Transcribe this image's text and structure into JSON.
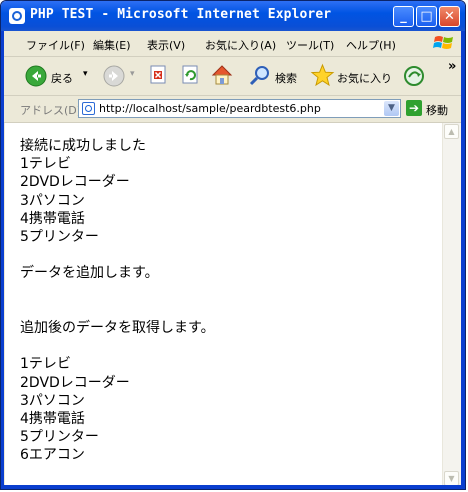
{
  "window": {
    "title": "PHP TEST - Microsoft Internet Explorer",
    "minimize_label": "_",
    "maximize_label": "□",
    "close_label": "✕"
  },
  "menu": {
    "items": [
      "ファイル(F)",
      "編集(E)",
      "表示(V)",
      "お気に入り(A)",
      "ツール(T)",
      "ヘルプ(H)"
    ]
  },
  "toolbar": {
    "back_label": "戻る",
    "search_label": "検索",
    "favorites_label": "お気に入り",
    "overflow_label": "»",
    "icons": [
      "back-icon",
      "forward-icon",
      "stop-icon",
      "refresh-icon",
      "home-icon",
      "search-icon",
      "favorites-icon",
      "media-icon"
    ]
  },
  "address": {
    "label": "アドレス(D)",
    "url": "http://localhost/sample/peardbtest6.php",
    "go_label": "移動"
  },
  "content": {
    "lines": [
      "接続に成功しました",
      "1テレビ",
      "2DVDレコーダー",
      "3パソコン",
      "4携帯電話",
      "5プリンター",
      "",
      "データを追加します。",
      "",
      "",
      "追加後のデータを取得します。",
      "",
      "1テレビ",
      "2DVDレコーダー",
      "3パソコン",
      "4携帯電話",
      "5プリンター",
      "6エアコン"
    ]
  },
  "colors": {
    "title_bar": "#0054e3",
    "chrome": "#ece9d8",
    "go_button": "#2fa12f"
  }
}
